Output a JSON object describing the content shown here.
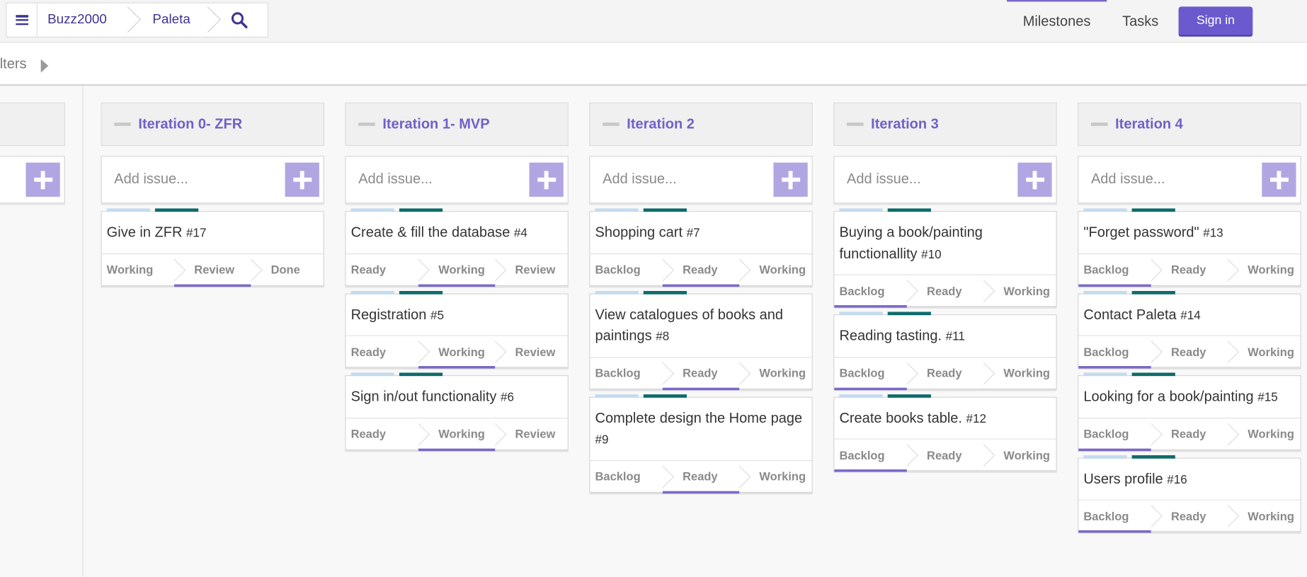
{
  "breadcrumb": {
    "menu_icon": "hamburger-icon",
    "items": [
      "Buzz2000",
      "Paleta"
    ],
    "search_icon": "search-icon"
  },
  "nav": {
    "milestones": "Milestones",
    "tasks": "Tasks",
    "sign_in": "Sign in"
  },
  "filters": {
    "label": "ilters"
  },
  "add_issue_placeholder": "Add issue...",
  "columns": [
    {
      "title": "Iteration 0- ZFR",
      "cards": [
        {
          "title": "Give in ZFR",
          "num": "#17",
          "states": [
            "Working",
            "Review",
            "Done"
          ],
          "active": 1
        }
      ]
    },
    {
      "title": "Iteration 1- MVP",
      "cards": [
        {
          "title": "Create & fill the database",
          "num": "#4",
          "states": [
            "Ready",
            "Working",
            "Review"
          ],
          "active": 1
        },
        {
          "title": "Registration",
          "num": "#5",
          "states": [
            "Ready",
            "Working",
            "Review"
          ],
          "active": 1
        },
        {
          "title": "Sign in/out functionality",
          "num": "#6",
          "states": [
            "Ready",
            "Working",
            "Review"
          ],
          "active": 1
        }
      ]
    },
    {
      "title": "Iteration 2",
      "cards": [
        {
          "title": "Shopping cart",
          "num": "#7",
          "states": [
            "Backlog",
            "Ready",
            "Working"
          ],
          "active": 1
        },
        {
          "title": "View catalogues of books and paintings",
          "num": "#8",
          "states": [
            "Backlog",
            "Ready",
            "Working"
          ],
          "active": 1
        },
        {
          "title": "Complete design the Home page",
          "num": "#9",
          "states": [
            "Backlog",
            "Ready",
            "Working"
          ],
          "active": 1
        }
      ]
    },
    {
      "title": "Iteration 3",
      "cards": [
        {
          "title": "Buying a book/painting functionallity",
          "num": "#10",
          "states": [
            "Backlog",
            "Ready",
            "Working"
          ],
          "active": 0
        },
        {
          "title": "Reading tasting.",
          "num": "#11",
          "states": [
            "Backlog",
            "Ready",
            "Working"
          ],
          "active": 0
        },
        {
          "title": "Create books table.",
          "num": "#12",
          "states": [
            "Backlog",
            "Ready",
            "Working"
          ],
          "active": 0
        }
      ]
    },
    {
      "title": "Iteration 4",
      "cards": [
        {
          "title": "\"Forget password\"",
          "num": "#13",
          "states": [
            "Backlog",
            "Ready",
            "Working"
          ],
          "active": 0
        },
        {
          "title": "Contact Paleta",
          "num": "#14",
          "states": [
            "Backlog",
            "Ready",
            "Working"
          ],
          "active": 0
        },
        {
          "title": "Looking for a book/painting",
          "num": "#15",
          "states": [
            "Backlog",
            "Ready",
            "Working"
          ],
          "active": 0
        },
        {
          "title": "Users profile",
          "num": "#16",
          "states": [
            "Backlog",
            "Ready",
            "Working"
          ],
          "active": 0
        }
      ]
    }
  ]
}
